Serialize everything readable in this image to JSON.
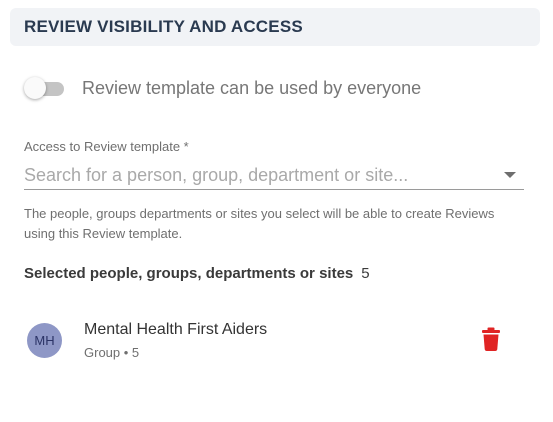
{
  "section": {
    "title": "REVIEW VISIBILITY AND ACCESS"
  },
  "toggle": {
    "label": "Review template can be used by everyone",
    "state": "off"
  },
  "access_field": {
    "label": "Access to Review template *",
    "placeholder": "Search for a person, group, department or site...",
    "value": "",
    "icon": "chevron-down-icon"
  },
  "helper_text": "The people, groups departments or sites you select will be able to create Reviews using this Review template.",
  "selected": {
    "heading": "Selected people, groups, departments or sites",
    "count": "5",
    "items": [
      {
        "initials": "MH",
        "name": "Mental Health First Aiders",
        "meta": "Group • 5",
        "delete_icon": "trash-icon"
      }
    ]
  },
  "colors": {
    "header_bg": "#f1f3f6",
    "header_text": "#2a3a50",
    "avatar_bg": "#8e97c6",
    "delete": "#e02424"
  }
}
